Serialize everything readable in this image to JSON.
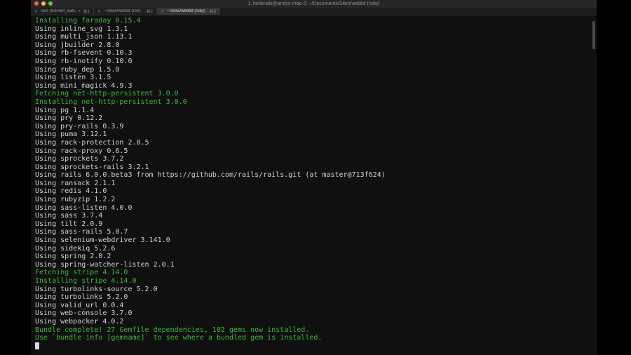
{
  "window": {
    "title": "1. hellorails@andys-mbp-2: ~/Documents/Sites/webbit (ruby)"
  },
  "tabs": [
    {
      "label": "rails (fsevent_watc...",
      "shortcut": "⌘1",
      "active": false,
      "bell": true
    },
    {
      "label": "~/Sites/webbit (zsh)",
      "shortcut": "⌘2",
      "active": false,
      "bell": false
    },
    {
      "label": "~/Sites/webbit (ruby)",
      "shortcut": "⌘3",
      "active": true,
      "bell": false
    }
  ],
  "colors": {
    "green": "#3fb93a",
    "text": "#d2d2d2",
    "background": "#101010"
  },
  "terminal": {
    "lines": [
      {
        "text": "Installing faraday 0.15.4",
        "green": true
      },
      {
        "text": "Using inline_svg 1.3.1",
        "green": false
      },
      {
        "text": "Using multi_json 1.13.1",
        "green": false
      },
      {
        "text": "Using jbuilder 2.8.0",
        "green": false
      },
      {
        "text": "Using rb-fsevent 0.10.3",
        "green": false
      },
      {
        "text": "Using rb-inotify 0.10.0",
        "green": false
      },
      {
        "text": "Using ruby_dep 1.5.0",
        "green": false
      },
      {
        "text": "Using listen 3.1.5",
        "green": false
      },
      {
        "text": "Using mini_magick 4.9.3",
        "green": false
      },
      {
        "text": "Fetching net-http-persistent 3.0.0",
        "green": true
      },
      {
        "text": "Installing net-http-persistent 3.0.0",
        "green": true
      },
      {
        "text": "Using pg 1.1.4",
        "green": false
      },
      {
        "text": "Using pry 0.12.2",
        "green": false
      },
      {
        "text": "Using pry-rails 0.3.9",
        "green": false
      },
      {
        "text": "Using puma 3.12.1",
        "green": false
      },
      {
        "text": "Using rack-protection 2.0.5",
        "green": false
      },
      {
        "text": "Using rack-proxy 0.6.5",
        "green": false
      },
      {
        "text": "Using sprockets 3.7.2",
        "green": false
      },
      {
        "text": "Using sprockets-rails 3.2.1",
        "green": false
      },
      {
        "text": "Using rails 6.0.0.beta3 from https://github.com/rails/rails.git (at master@713f624)",
        "green": false
      },
      {
        "text": "Using ransack 2.1.1",
        "green": false
      },
      {
        "text": "Using redis 4.1.0",
        "green": false
      },
      {
        "text": "Using rubyzip 1.2.2",
        "green": false
      },
      {
        "text": "Using sass-listen 4.0.0",
        "green": false
      },
      {
        "text": "Using sass 3.7.4",
        "green": false
      },
      {
        "text": "Using tilt 2.0.9",
        "green": false
      },
      {
        "text": "Using sass-rails 5.0.7",
        "green": false
      },
      {
        "text": "Using selenium-webdriver 3.141.0",
        "green": false
      },
      {
        "text": "Using sidekiq 5.2.6",
        "green": false
      },
      {
        "text": "Using spring 2.0.2",
        "green": false
      },
      {
        "text": "Using spring-watcher-listen 2.0.1",
        "green": false
      },
      {
        "text": "Fetching stripe 4.14.0",
        "green": true
      },
      {
        "text": "Installing stripe 4.14.0",
        "green": true
      },
      {
        "text": "Using turbolinks-source 5.2.0",
        "green": false
      },
      {
        "text": "Using turbolinks 5.2.0",
        "green": false
      },
      {
        "text": "Using valid_url 0.0.4",
        "green": false
      },
      {
        "text": "Using web-console 3.7.0",
        "green": false
      },
      {
        "text": "Using webpacker 4.0.2",
        "green": false
      },
      {
        "text": "Bundle complete! 27 Gemfile dependencies, 102 gems now installed.",
        "green": true
      },
      {
        "text": "Use `bundle info [gemname]` to see where a bundled gem is installed.",
        "green": true
      }
    ]
  }
}
